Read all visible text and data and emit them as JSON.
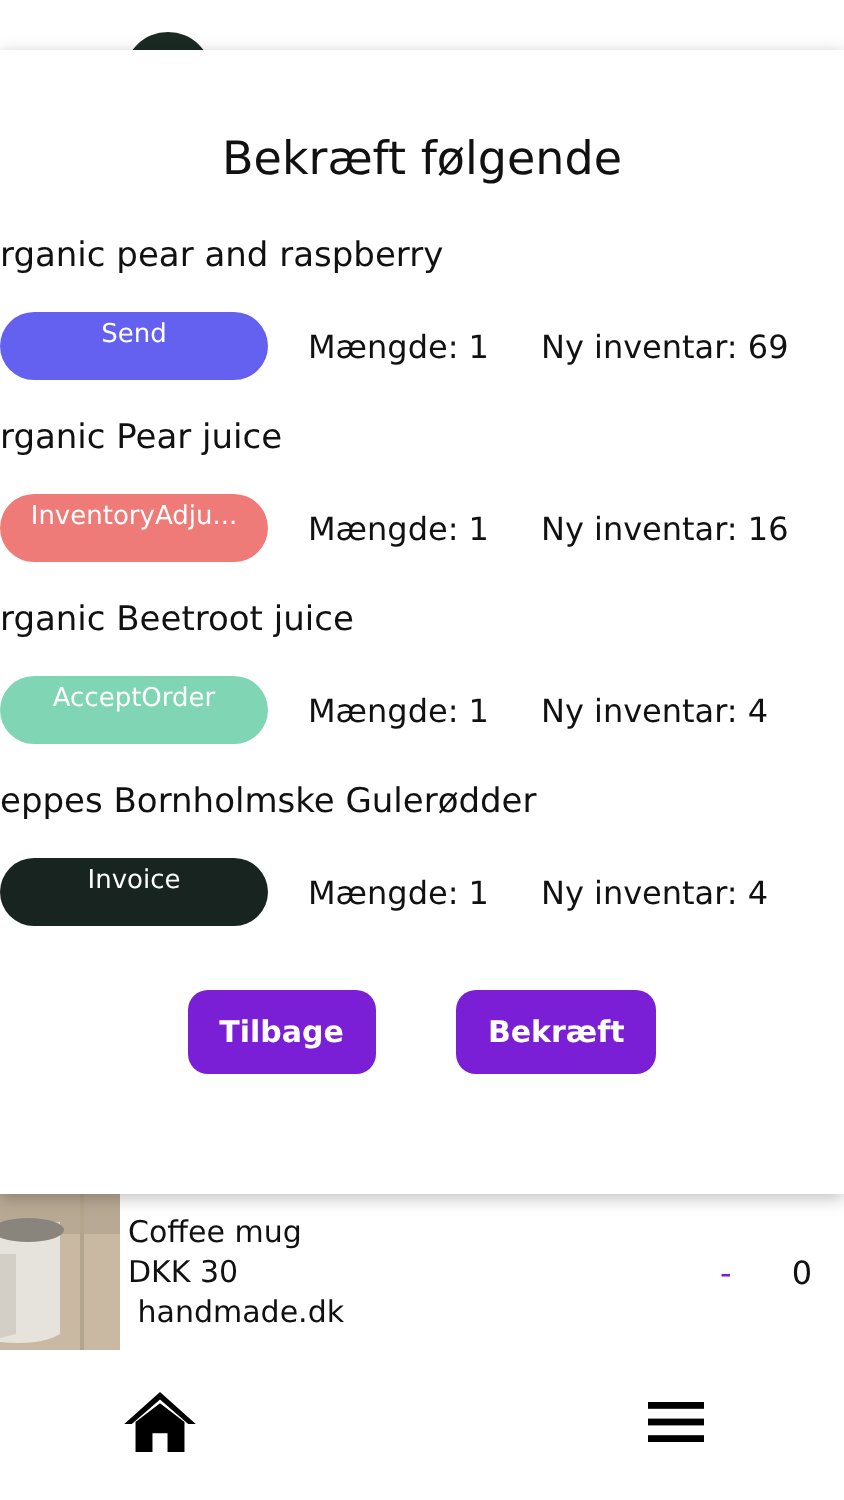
{
  "dialog": {
    "title": "Bekræft følgende",
    "items": [
      {
        "name": "rganic pear and raspberry",
        "action": "Send",
        "color": "#6461f0",
        "quantity": "Mængde: 1",
        "inventory": "Ny inventar: 69"
      },
      {
        "name": "rganic Pear juice",
        "action": "InventoryAdju...",
        "color": "#ef7b78",
        "quantity": "Mængde: 1",
        "inventory": "Ny inventar: 16"
      },
      {
        "name": "rganic Beetroot juice",
        "action": "AcceptOrder",
        "color": "#80d6b4",
        "quantity": "Mængde: 1",
        "inventory": "Ny inventar: 4"
      },
      {
        "name": "eppes Bornholmske Gulerødder",
        "action": "Invoice",
        "color": "#17241f",
        "quantity": "Mængde: 1",
        "inventory": "Ny inventar: 4"
      }
    ],
    "buttons": [
      "Tilbage",
      "Bekræft"
    ]
  },
  "product": {
    "kind": "picture",
    "name": "Coffee mug",
    "price": "DKK 30",
    "seller": " handmade.dk",
    "minus": "-",
    "count": "0"
  }
}
